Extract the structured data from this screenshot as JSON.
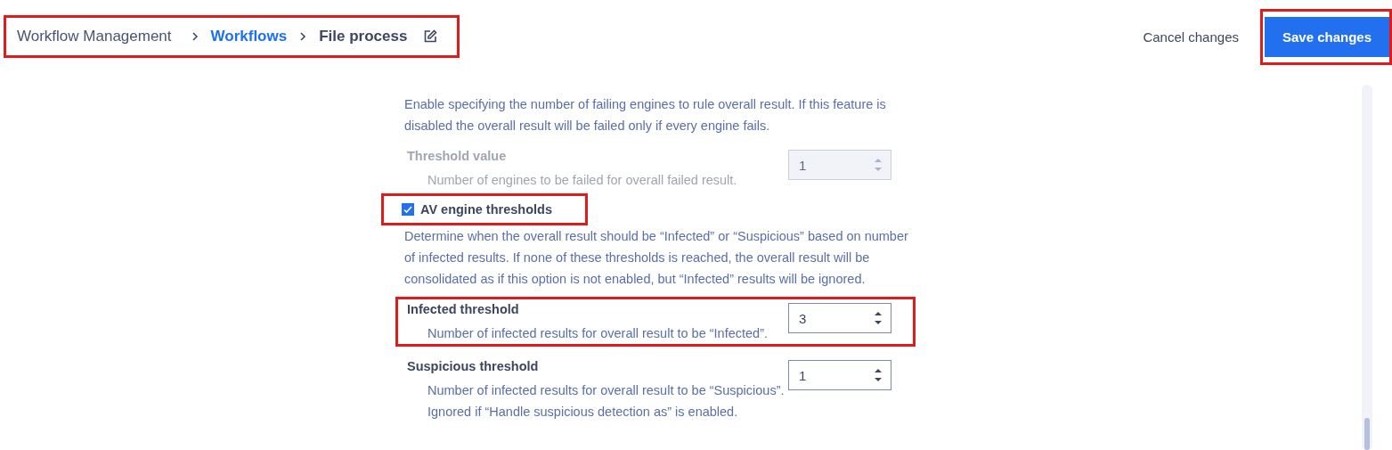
{
  "breadcrumb": {
    "highlighted": true,
    "items": [
      {
        "label": "Workflow Management",
        "kind": "plain"
      },
      {
        "label": "Workflows",
        "kind": "link"
      },
      {
        "label": "File process",
        "kind": "current"
      }
    ]
  },
  "actions": [
    {
      "label": "Cancel changes",
      "kind": "text",
      "highlighted": false
    },
    {
      "label": "Save changes",
      "kind": "primary",
      "highlighted": true
    }
  ],
  "settings": [
    {
      "kind": "description",
      "text": "Enable specifying the number of failing engines to rule overall result. If this feature is disabled the overall result will be failed only if every engine fails."
    },
    {
      "kind": "number",
      "label": "Threshold value",
      "hint": "Number of engines to be failed for overall failed result.",
      "value": "1",
      "disabled": true,
      "highlighted": false
    },
    {
      "kind": "checkbox",
      "label": "AV engine thresholds",
      "checked": true,
      "highlighted": true
    },
    {
      "kind": "description",
      "text": "Determine when the overall result should be “Infected” or “Suspicious” based on number of infected results. If none of these thresholds is reached, the overall result will be consolidated as if this option is not enabled, but “Infected” results will be ignored."
    },
    {
      "kind": "number",
      "label": "Infected threshold",
      "hint": "Number of infected results for overall result to be “Infected”.",
      "value": "3",
      "disabled": false,
      "highlighted": true
    },
    {
      "kind": "number",
      "label": "Suspicious threshold",
      "hint": "Number of infected results for overall result to be “Suspicious”. Ignored if “Handle suspicious detection as” is enabled.",
      "value": "1",
      "disabled": false,
      "highlighted": false
    }
  ]
}
